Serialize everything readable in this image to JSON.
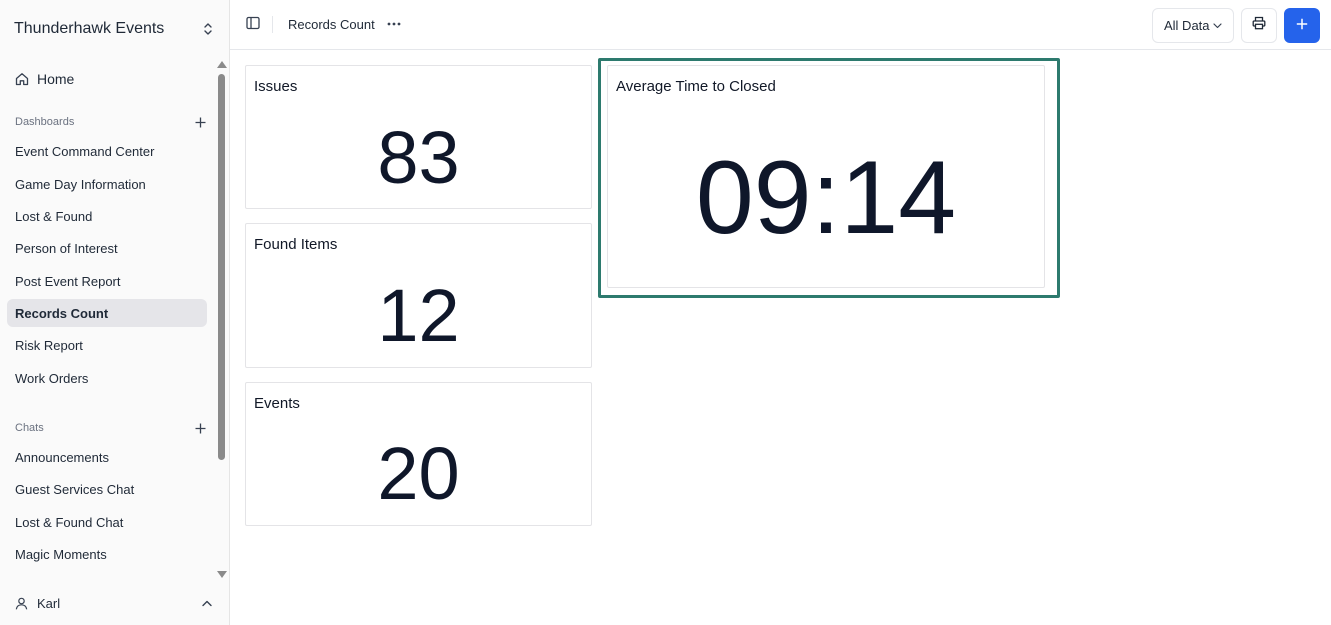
{
  "sidebar": {
    "workspace_name": "Thunderhawk Events",
    "home_label": "Home",
    "dashboards_label": "Dashboards",
    "dashboards": [
      {
        "label": "Event Command Center"
      },
      {
        "label": "Game Day Information"
      },
      {
        "label": "Lost & Found"
      },
      {
        "label": "Person of Interest"
      },
      {
        "label": "Post Event Report"
      },
      {
        "label": "Records Count",
        "active": true
      },
      {
        "label": "Risk Report"
      },
      {
        "label": "Work Orders"
      }
    ],
    "chats_label": "Chats",
    "chats": [
      {
        "label": "Announcements"
      },
      {
        "label": "Guest Services Chat"
      },
      {
        "label": "Lost & Found Chat"
      },
      {
        "label": "Magic Moments"
      }
    ],
    "user_name": "Karl"
  },
  "topbar": {
    "title": "Records Count",
    "filter_label": "All Data"
  },
  "cards": {
    "issues": {
      "title": "Issues",
      "value": "83"
    },
    "found_items": {
      "title": "Found Items",
      "value": "12"
    },
    "events": {
      "title": "Events",
      "value": "20"
    },
    "avg_time": {
      "title": "Average Time to Closed",
      "value": "09:14"
    }
  },
  "colors": {
    "accent": "#2563eb",
    "selection": "#2d7a6e",
    "active_nav": "#e5e5e9"
  }
}
